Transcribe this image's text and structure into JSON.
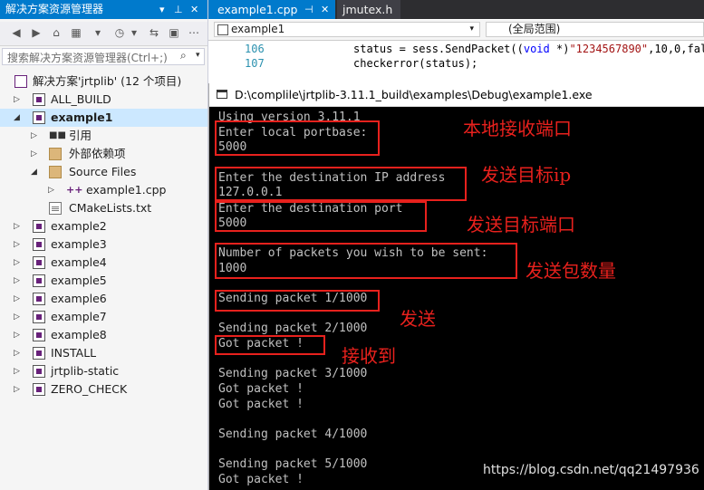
{
  "solution_explorer": {
    "title": "解决方案资源管理器",
    "search_placeholder": "搜索解决方案资源管理器(Ctrl+;)",
    "solution_label": "解决方案'jrtplib' (12 个项目)",
    "items": [
      {
        "label": "ALL_BUILD"
      },
      {
        "label": "example1"
      },
      {
        "label": "引用"
      },
      {
        "label": "外部依赖项"
      },
      {
        "label": "Source Files"
      },
      {
        "label": "example1.cpp"
      },
      {
        "label": "CMakeLists.txt"
      },
      {
        "label": "example2"
      },
      {
        "label": "example3"
      },
      {
        "label": "example4"
      },
      {
        "label": "example5"
      },
      {
        "label": "example6"
      },
      {
        "label": "example7"
      },
      {
        "label": "example8"
      },
      {
        "label": "INSTALL"
      },
      {
        "label": "jrtplib-static"
      },
      {
        "label": "ZERO_CHECK"
      }
    ]
  },
  "editor": {
    "tabs": [
      {
        "label": "example1.cpp"
      },
      {
        "label": "jmutex.h"
      }
    ],
    "nav_left": "example1",
    "nav_right": "(全局范围)",
    "lines": [
      {
        "num": "106",
        "pre": "status = sess.SendPacket((",
        "kw": "void",
        "mid": " *)",
        "str": "\"1234567890\"",
        "post": ",10,0,fal"
      },
      {
        "num": "107",
        "pre": "checkerror(status);"
      }
    ]
  },
  "console": {
    "title": "D:\\complile\\jrtplib-3.11.1_build\\examples\\Debug\\example1.exe",
    "lines": [
      "Using version 3.11.1",
      "Enter local portbase:",
      "5000",
      "",
      "Enter the destination IP address",
      "127.0.0.1",
      "Enter the destination port",
      "5000",
      "",
      "Number of packets you wish to be sent:",
      "1000",
      "",
      "Sending packet 1/1000",
      "",
      "Sending packet 2/1000",
      "Got packet !",
      "",
      "Sending packet 3/1000",
      "Got packet !",
      "Got packet !",
      "",
      "Sending packet 4/1000",
      "",
      "Sending packet 5/1000",
      "Got packet !"
    ],
    "annotations": [
      "本地接收端口",
      "发送目标ip",
      "发送目标端口",
      "发送包数量",
      "发送",
      "接收到"
    ],
    "watermark": "https://blog.csdn.net/qq21497936"
  },
  "colors": {
    "accent": "#007acc",
    "annotation_red": "#e8211d",
    "console_bg": "#000000",
    "console_text": "#c0c0c0"
  }
}
